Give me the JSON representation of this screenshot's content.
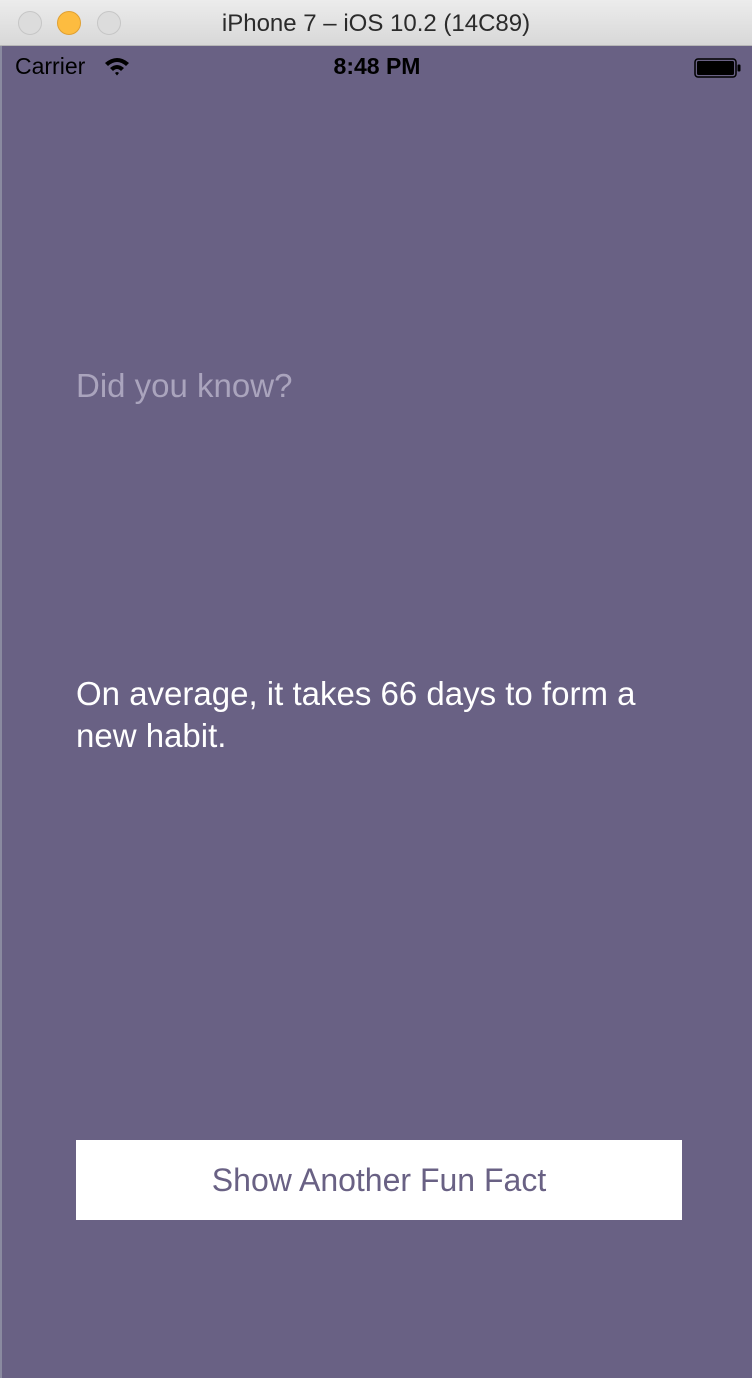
{
  "window": {
    "title": "iPhone 7 – iOS 10.2 (14C89)"
  },
  "status_bar": {
    "carrier": "Carrier",
    "time": "8:48 PM",
    "icons": [
      "wifi-icon",
      "battery-icon"
    ]
  },
  "content": {
    "header": "Did you know?",
    "fact": "On average, it takes 66 days to form a new habit.",
    "button_label": "Show Another Fun Fact"
  },
  "colors": {
    "background": "#696184",
    "header_text": "#aaa4bd",
    "fact_text": "#ffffff",
    "button_background": "#ffffff",
    "button_text": "#696184"
  }
}
